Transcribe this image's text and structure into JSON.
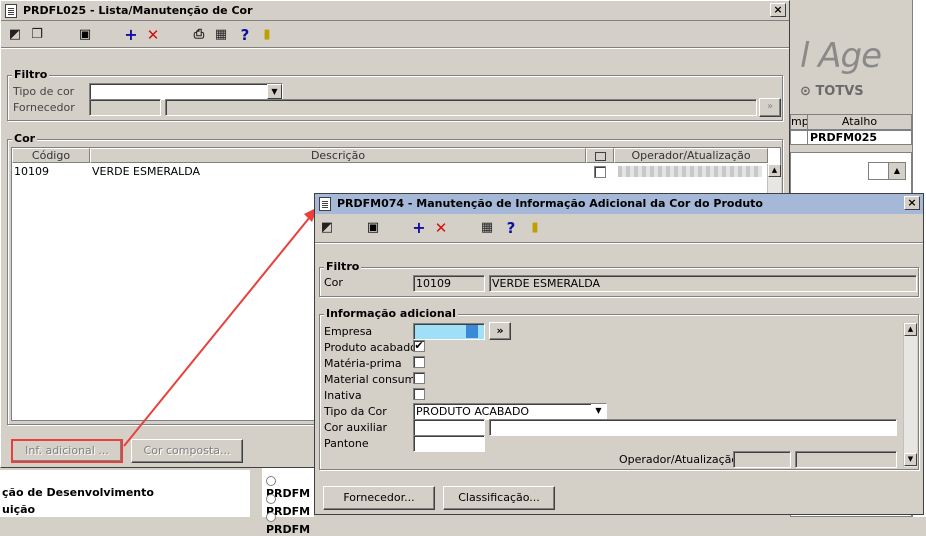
{
  "background": {
    "logo_text": "l Age",
    "logo_brand": "TOTVS",
    "columns": [
      "mp.",
      "Atalho"
    ],
    "atalho_value": "PRDFM025",
    "left_items": [
      "ção de Desenvolvimento",
      "uição"
    ],
    "mid_items": [
      "PRDFM",
      "PRDFM",
      "PRDFM"
    ]
  },
  "window_list": {
    "title": "PRDFL025 - Lista/Manutenção de Cor",
    "close": "×",
    "filtro_label": "Filtro",
    "tipo_cor_label": "Tipo de cor",
    "fornecedor_label": "Fornecedor",
    "cor_label": "Cor",
    "columns": [
      "Código",
      "Descrição",
      "",
      "Operador/Atualização"
    ],
    "rows": [
      {
        "codigo": "10109",
        "descricao": "VERDE ESMERALDA"
      }
    ],
    "btn_inf_adicional": "Inf. adicional ...",
    "btn_cor_composta": "Cor composta..."
  },
  "window_info": {
    "title": "PRDFM074 - Manutenção de Informação Adicional da Cor do Produto",
    "close": "×",
    "filtro_label": "Filtro",
    "cor_label": "Cor",
    "cor_codigo": "10109",
    "cor_descricao": "VERDE ESMERALDA",
    "info_label": "Informação adicional",
    "empresa_label": "Empresa",
    "empresa_btn": "»",
    "produto_acabado_label": "Produto acabado",
    "produto_acabado_checked": "✔",
    "materia_prima_label": "Matéria-prima",
    "material_consumo_label": "Material consumo",
    "inativa_label": "Inativa",
    "tipo_cor_label": "Tipo da Cor",
    "tipo_cor_value": "PRODUTO ACABADO",
    "cor_auxiliar_label": "Cor auxiliar",
    "pantone_label": "Pantone",
    "operador_label": "Operador/Atualização",
    "btn_fornecedor": "Fornecedor...",
    "btn_classificacao": "Classificação..."
  },
  "colors": {
    "active_title": "#a6b8d8",
    "annotation": "#e8403c"
  }
}
